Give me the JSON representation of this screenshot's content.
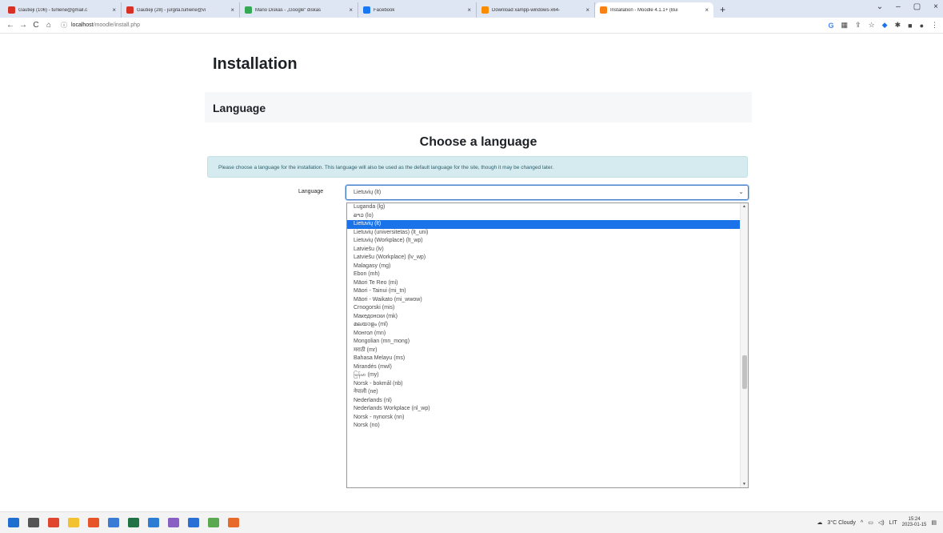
{
  "browser": {
    "tabs": [
      {
        "title": "Gautieji (106) - turliene@gmail.c",
        "favicon_color": "#d93025",
        "active": false
      },
      {
        "title": "Gautieji (28) - jurgita.turliene@vi",
        "favicon_color": "#d93025",
        "active": false
      },
      {
        "title": "Mano Diskas - „Google“ diskas",
        "favicon_color": "#34a853",
        "active": false
      },
      {
        "title": "Facebook",
        "favicon_color": "#1877f2",
        "active": false
      },
      {
        "title": "Download xampp-windows-x64-",
        "favicon_color": "#fb8c00",
        "active": false
      },
      {
        "title": "Installation - Moodle 4.1.1+ (Bui",
        "favicon_color": "#f98012",
        "active": true
      }
    ],
    "tab_close": "×",
    "new_tab": "+",
    "window_controls": {
      "chevron": "⌄",
      "minimize": "–",
      "maximize": "▢",
      "close": "×"
    },
    "url_host": "localhost",
    "url_path": "/moodle/install.php",
    "nav": {
      "back": "←",
      "forward": "→",
      "reload": "C",
      "home": "⌂",
      "info": "ⓘ"
    }
  },
  "page": {
    "title": "Installation",
    "section_title": "Language",
    "heading": "Choose a language",
    "notice": "Please choose a language for the installation. This language will also be used as the default language for the site, though it may be changed later.",
    "field_label": "Language",
    "selected_value": "Lietuvių (lt)",
    "options": [
      "Luganda (lg)",
      "ລາວ (lo)",
      "Lietuvių (lt)",
      "Lietuvių (universitetas) (lt_uni)",
      "Lietuvių (Workplace) (lt_wp)",
      "Latviešu (lv)",
      "Latviešu (Workplace) (lv_wp)",
      "Malagasy (mg)",
      "Ebon (mh)",
      "Māori Te Reo (mi)",
      "Māori - Tainui (mi_tn)",
      "Māori - Waikato (mi_wwow)",
      "Crnogorski (mis)",
      "Македонски (mk)",
      "മലയാളം (ml)",
      "Монгол (mn)",
      "Mongolian (mn_mong)",
      "मराठी (mr)",
      "Bahasa Melayu (ms)",
      "Mirandés (mwl)",
      "မြန်မာ (my)",
      "Norsk - bokmål (nb)",
      "नेपाली (ne)",
      "Nederlands (nl)",
      "Nederlands Workplace (nl_wp)",
      "Norsk - nynorsk (nn)",
      "Norsk (no)"
    ],
    "selected_index": 2
  },
  "taskbar": {
    "icon_colors": [
      "#1f6fd1",
      "#555555",
      "#e0452f",
      "#f2c230",
      "#e8542a",
      "#3a7bd5",
      "#217346",
      "#2b7cd3",
      "#8a5fc4",
      "#2a6fd6",
      "#5aa84f",
      "#e86a2a"
    ],
    "weather": "3°C Cloudy",
    "lang": "LIT",
    "time": "15:24",
    "date": "2023-01-15"
  }
}
